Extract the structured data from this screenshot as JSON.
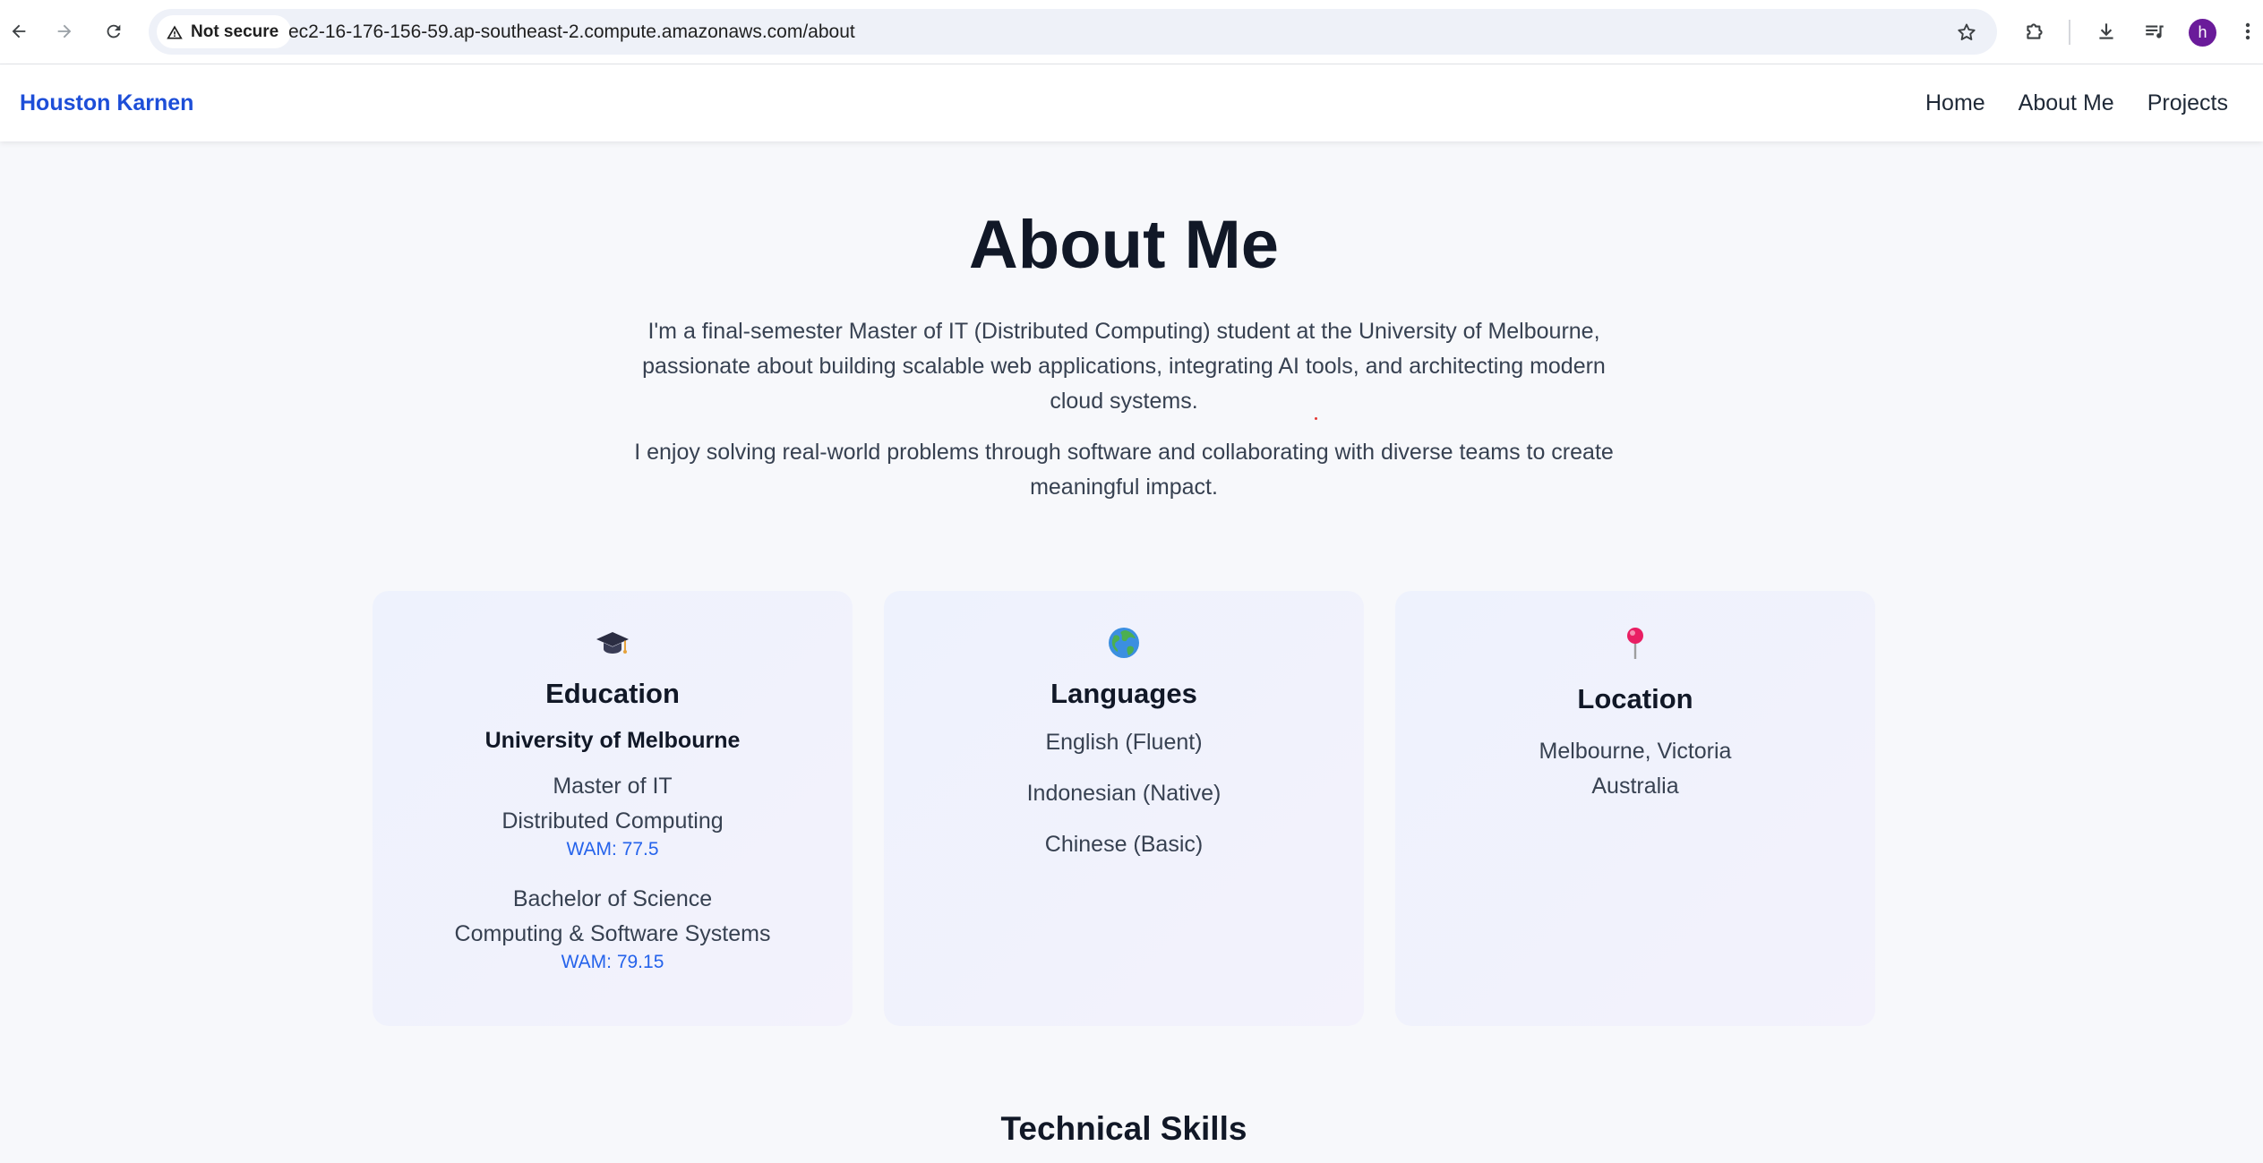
{
  "browser": {
    "security_label": "Not secure",
    "url": "ec2-16-176-156-59.ap-southeast-2.compute.amazonaws.com/about",
    "profile_initial": "h"
  },
  "site": {
    "brand": "Houston Karnen",
    "nav": [
      "Home",
      "About Me",
      "Projects"
    ]
  },
  "main": {
    "title": "About Me",
    "intro_1": "I'm a final-semester Master of IT (Distributed Computing) student at the University of Melbourne, passionate about building scalable web applications, integrating AI tools, and architecting modern cloud systems.",
    "intro_2": "I enjoy solving real-world problems through software and collaborating with diverse teams to create meaningful impact."
  },
  "cards": {
    "education": {
      "icon": "graduation-cap-icon",
      "title": "Education",
      "university": "University of Melbourne",
      "degree_1_line_1": "Master of IT",
      "degree_1_line_2": "Distributed Computing",
      "degree_1_wam": "WAM: 77.5",
      "degree_2_line_1": "Bachelor of Science",
      "degree_2_line_2": "Computing & Software Systems",
      "degree_2_wam": "WAM: 79.15"
    },
    "languages": {
      "icon": "globe-icon",
      "title": "Languages",
      "items": [
        "English (Fluent)",
        "Indonesian (Native)",
        "Chinese (Basic)"
      ]
    },
    "location": {
      "icon": "map-pin-icon",
      "title": "Location",
      "line_1": "Melbourne, Victoria",
      "line_2": "Australia"
    }
  },
  "skills": {
    "title": "Technical Skills"
  },
  "colors": {
    "brand": "#1d4ed8",
    "wam": "#2563eb",
    "background": "#f7f8fb",
    "card_gradient_start": "#eef2fd",
    "card_gradient_end": "#f3f2fc"
  }
}
